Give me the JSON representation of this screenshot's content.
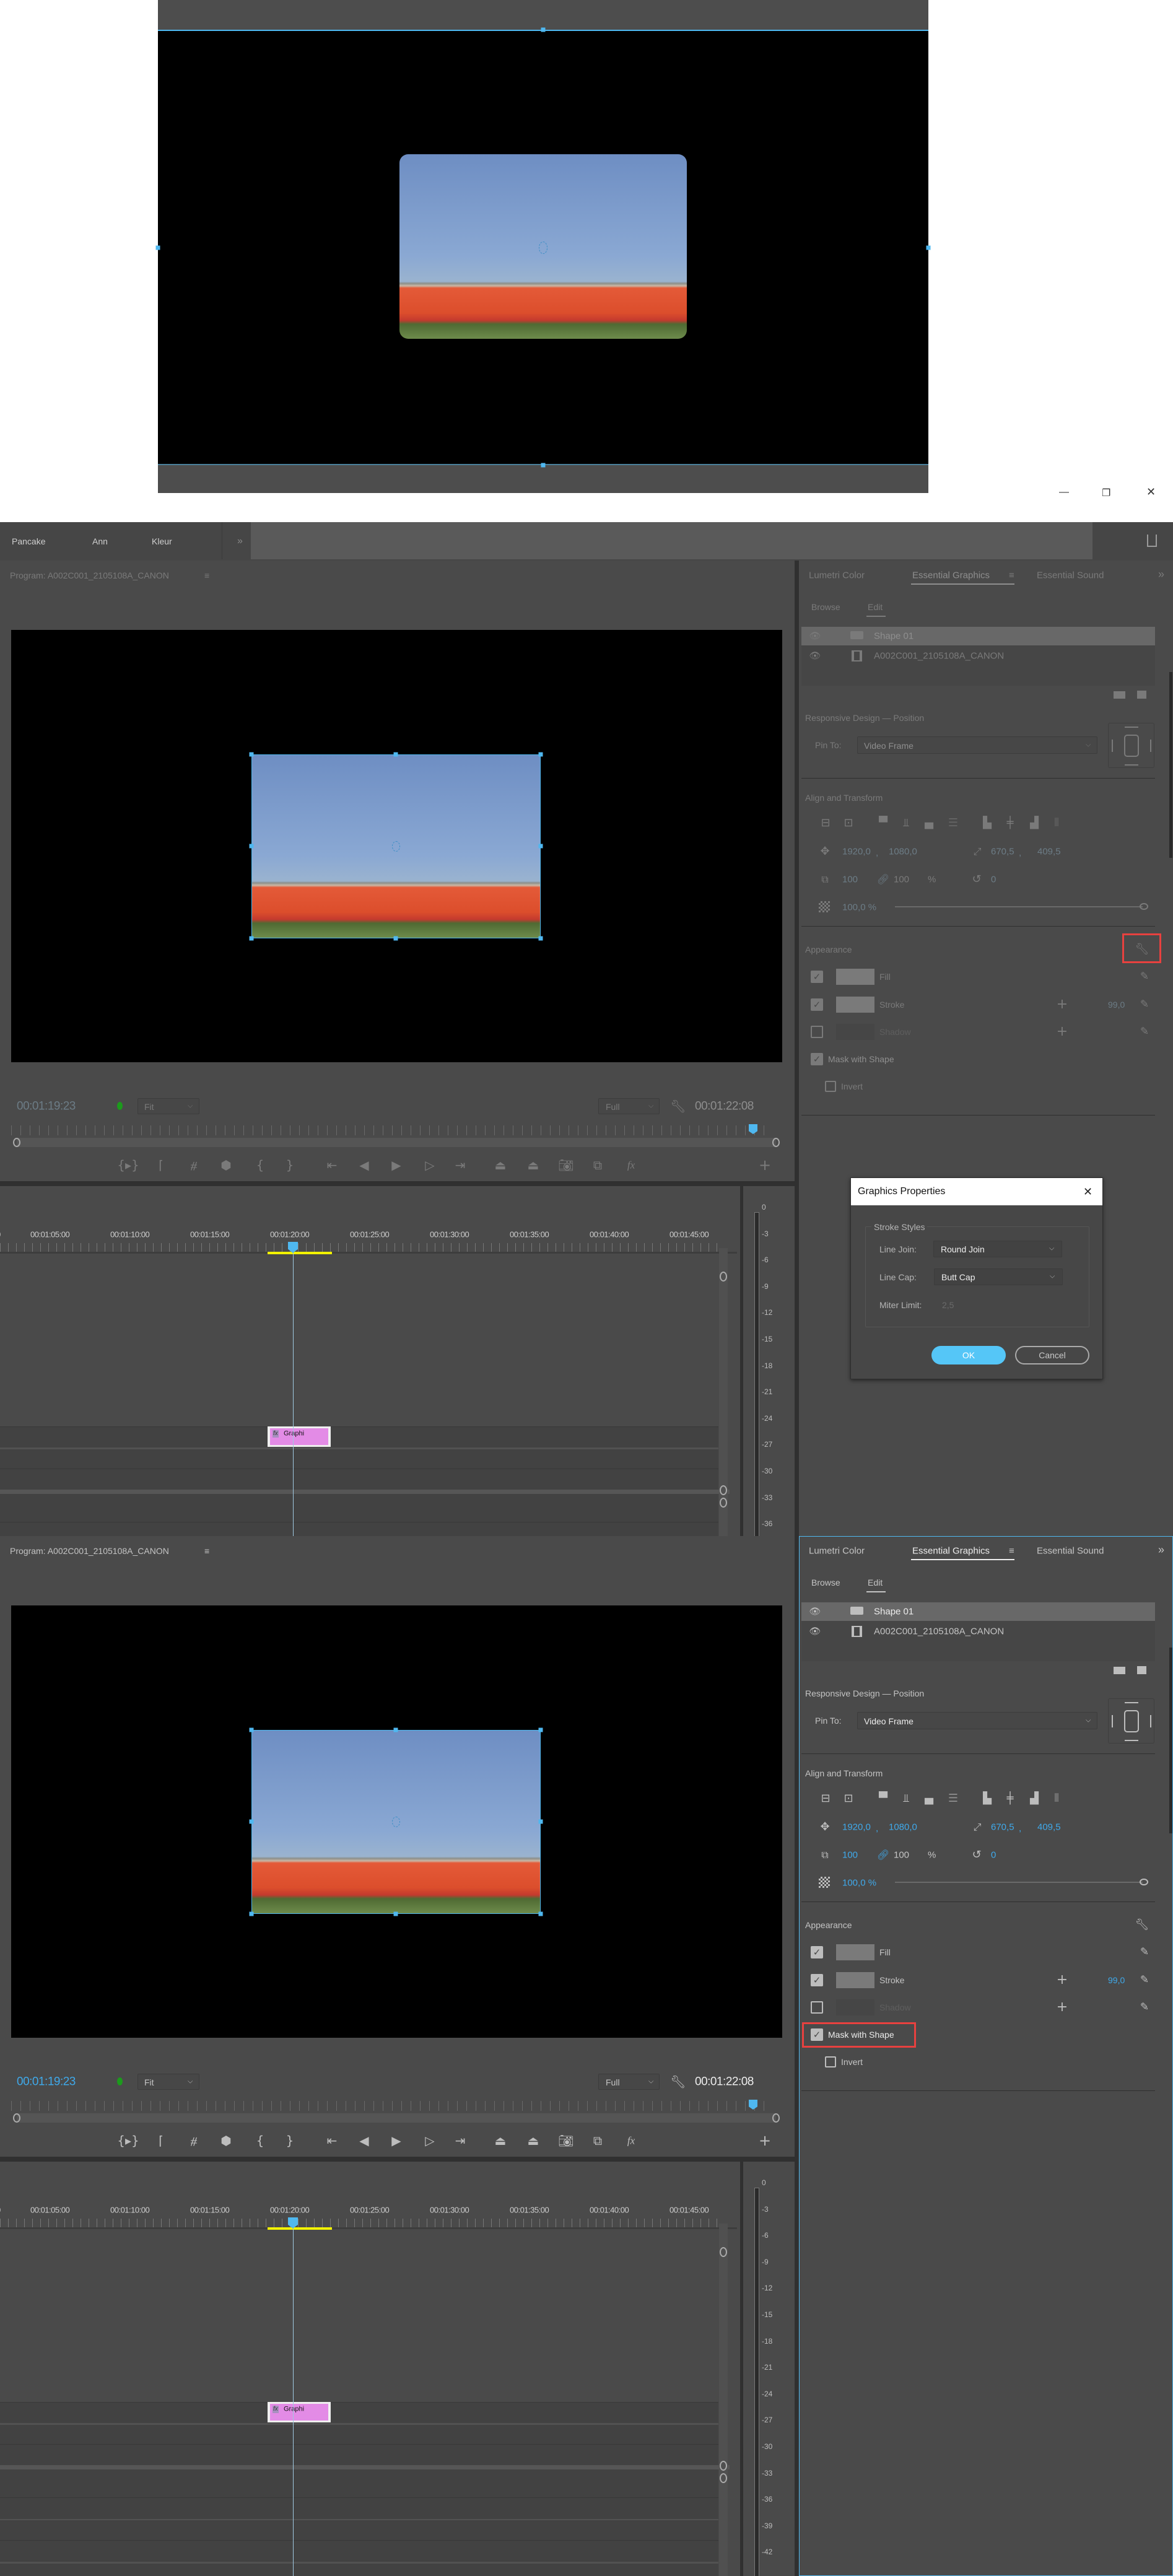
{
  "window_controls": {
    "minimize": "minimize-icon",
    "restore": "restore-icon",
    "close": "close-icon"
  },
  "workspaces": {
    "items": [
      "Pancake",
      "Ann",
      "Kleur"
    ],
    "more": "»"
  },
  "program": {
    "title": "Program: A002C001_2105108A_CANON",
    "menu": "≡",
    "timecode_current": "00:01:19:23",
    "zoom_level": "Fit",
    "resolution": "Full",
    "timecode_duration": "00:01:22:08",
    "fx_button": "fx"
  },
  "timeline": {
    "ruler": [
      "00:01:05:00",
      "00:01:10:00",
      "00:01:15:00",
      "00:01:20:00",
      "00:01:25:00",
      "00:01:30:00",
      "00:01:35:00",
      "00:01:40:00",
      "00:01:45:00"
    ],
    "clip_fx": "fx",
    "clip_label": "Graphi",
    "meter": [
      "0",
      "-3",
      "-6",
      "-9",
      "-12",
      "-15",
      "-18",
      "-21",
      "-24",
      "-27",
      "-30",
      "-33",
      "-36",
      "-39",
      "-42"
    ]
  },
  "essential_graphics": {
    "tabs": [
      "Lumetri Color",
      "Essential Graphics",
      "Essential Sound"
    ],
    "tab_menu": "≡",
    "tab_more": "»",
    "subtabs": [
      "Browse",
      "Edit"
    ],
    "layers": [
      "Shape 01",
      "A002C001_2105108A_CANON"
    ],
    "responsive_title": "Responsive Design — Position",
    "pin_to_label": "Pin To:",
    "pin_to_value": "Video Frame",
    "align_title": "Align and Transform",
    "position_x": "1920,0",
    "position_y": "1080,0",
    "comma": ",",
    "anchor_x": "670,5",
    "anchor_y": "409,5",
    "scale_w": "100",
    "scale_h": "100",
    "scale_unit": "%",
    "rotation": "0",
    "opacity": "100,0 %",
    "opacity_fraction": 1.0,
    "appearance_title": "Appearance",
    "fill_label": "Fill",
    "fill_checked": true,
    "stroke_label": "Stroke",
    "stroke_checked": true,
    "stroke_width": "99,0",
    "shadow_label": "Shadow",
    "shadow_checked": false,
    "mask_label": "Mask with Shape",
    "mask_checked": true,
    "invert_label": "Invert",
    "invert_checked": false
  },
  "dialog": {
    "title": "Graphics Properties",
    "group": "Stroke Styles",
    "line_join_label": "Line Join:",
    "line_join_value": "Round Join",
    "line_cap_label": "Line Cap:",
    "line_cap_value": "Butt Cap",
    "miter_label": "Miter Limit:",
    "miter_value": "2,5",
    "ok": "OK",
    "cancel": "Cancel"
  },
  "colors": {
    "accent": "#4fb8f0",
    "highlight_box": "#e8413f",
    "clip": "#e38be6",
    "in_out_bar": "#f2f200",
    "ok_button": "#55c6f7"
  }
}
